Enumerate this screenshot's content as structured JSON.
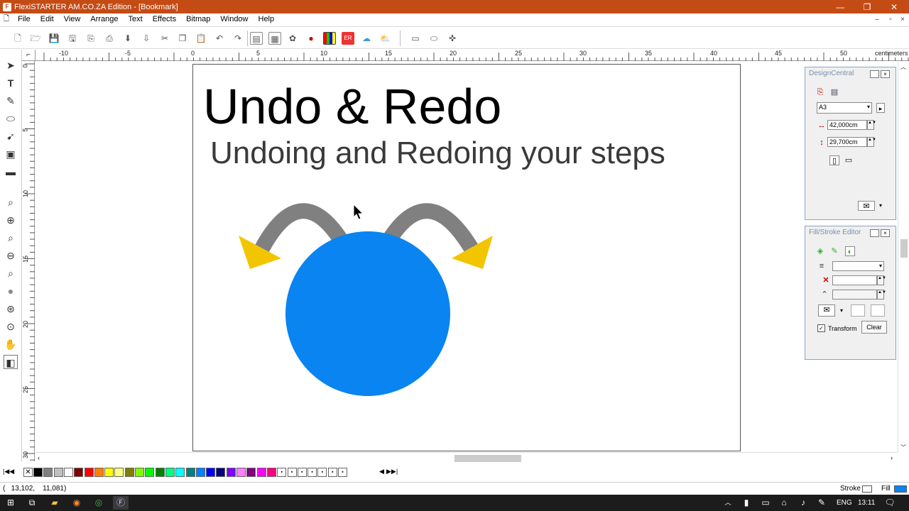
{
  "window": {
    "title": "FlexiSTARTER AM.CO.ZA Edition - [Bookmark]",
    "app_icon": "flexi-icon",
    "minimize_glyph": "—",
    "restore_glyph": "❐",
    "close_glyph": "✕"
  },
  "menu": {
    "items": [
      "File",
      "Edit",
      "View",
      "Arrange",
      "Text",
      "Effects",
      "Bitmap",
      "Window",
      "Help"
    ],
    "mdi_min": "–",
    "mdi_restore": "▫",
    "mdi_close": "×"
  },
  "ruler": {
    "unit": "centimeters",
    "h_ticks": [
      "-10",
      "-5",
      "0",
      "5",
      "10",
      "15",
      "20",
      "25",
      "30",
      "35",
      "40",
      "45",
      "50"
    ],
    "v_ticks": [
      "0",
      "5",
      "10",
      "15",
      "20",
      "25",
      "30"
    ]
  },
  "document": {
    "title": "Undo & Redo",
    "subtitle": "Undoing and Redoing your steps",
    "colors": {
      "circle": "#0a84f0",
      "arrow_body": "#808080",
      "arrow_head": "#f2c500"
    }
  },
  "design_central": {
    "title": "DesignCentral",
    "size_preset": "A3",
    "width": "42,000cm",
    "height": "29,700cm"
  },
  "fill_stroke": {
    "title": "Fill/Stroke Editor",
    "transform_label": "Transform",
    "transform_checked": "✓",
    "clear_label": "Clear"
  },
  "palette": {
    "nav_first": "|◀◀",
    "nav_prev": "◀",
    "nav_next": "▶",
    "nav_last": "▶▶|",
    "colors": [
      "#000000",
      "#808080",
      "#c0c0c0",
      "#ffffff",
      "#800000",
      "#ff0000",
      "#ff8000",
      "#ffff00",
      "#ffff80",
      "#808000",
      "#80ff00",
      "#00ff00",
      "#008000",
      "#00ff80",
      "#00ffff",
      "#008080",
      "#0080ff",
      "#0000ff",
      "#000080",
      "#8000ff",
      "#ff80ff",
      "#800080",
      "#ff00ff",
      "#ff0080"
    ]
  },
  "status": {
    "coords": "(   13,102,    11,081)",
    "stroke_label": "Stroke",
    "fill_label": "Fill"
  },
  "taskbar": {
    "lang": "ENG",
    "time": "13:11"
  }
}
